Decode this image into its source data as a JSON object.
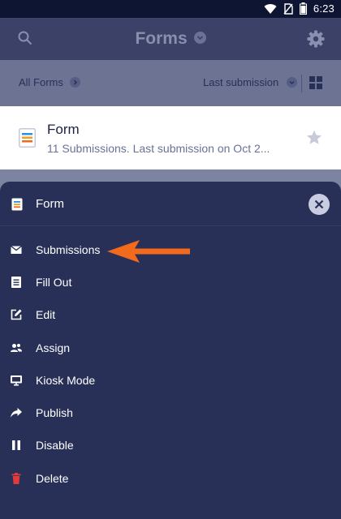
{
  "status_bar": {
    "time": "6:23",
    "icons": [
      "wifi-icon",
      "no-sim-icon",
      "battery-icon"
    ]
  },
  "header": {
    "title": "Forms",
    "icons": [
      "search-icon",
      "chevron-down-icon",
      "gear-icon"
    ]
  },
  "toolbar": {
    "all_forms_label": "All Forms",
    "sort_label": "Last submission",
    "icons": [
      "chevron-right-icon",
      "chevron-down-icon",
      "grid-icon"
    ]
  },
  "form_card": {
    "name": "Form",
    "meta": "11 Submissions. Last submission on Oct 2...",
    "icons": [
      "form-icon",
      "star-icon"
    ]
  },
  "sheet": {
    "title": "Form",
    "menu": [
      {
        "label": "Submissions",
        "icon": "envelope-icon"
      },
      {
        "label": "Fill Out",
        "icon": "document-icon"
      },
      {
        "label": "Edit",
        "icon": "edit-icon"
      },
      {
        "label": "Assign",
        "icon": "users-icon"
      },
      {
        "label": "Kiosk Mode",
        "icon": "monitor-icon"
      },
      {
        "label": "Publish",
        "icon": "share-icon"
      },
      {
        "label": "Disable",
        "icon": "pause-icon"
      },
      {
        "label": "Delete",
        "icon": "trash-icon"
      }
    ]
  },
  "colors": {
    "header_bg": "#3b4167",
    "sheet_bg": "#283057",
    "accent_orange": "#f26a1b",
    "delete_red": "#e23a3a",
    "star_gray": "#c7cad8"
  }
}
